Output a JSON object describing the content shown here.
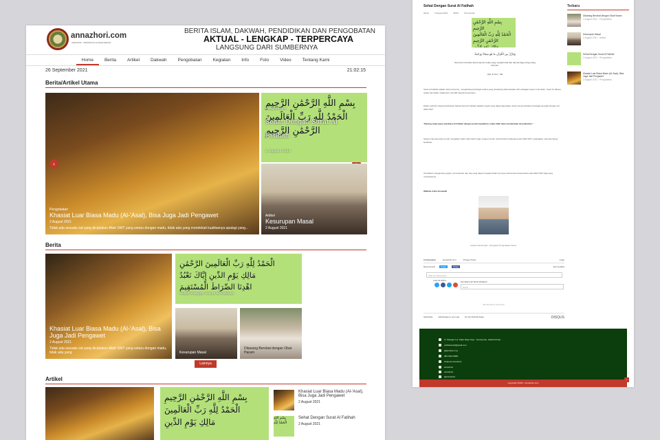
{
  "left": {
    "site": {
      "name": "annazhori.com",
      "tagline": "AMAZHORI - PENDIDIKAN & PENGOBATAN"
    },
    "header": {
      "line1": "BERITA ISLAM, DAKWAH, PENDIDIKAN DAN PENGOBATAN",
      "line2": "AKTUAL - LENGKAP - TERPERCAYA",
      "line3": "LANGSUNG DARI SUMBERNYA"
    },
    "nav": [
      "Home",
      "Berita",
      "Artikel",
      "Dakwah",
      "Pengobatan",
      "Kegiatan",
      "Info",
      "Foto",
      "Video",
      "Tentang Kami"
    ],
    "date": "26 September 2021",
    "time": "21:02:15",
    "sections": {
      "utama": "Berita/Artikel Utama",
      "berita": "Berita",
      "artikel": "Artikel"
    },
    "slider": {
      "category": "Pengobatan",
      "title": "Khasiat Luar Biasa Madu (Al-'Asal), Bisa Juga Jadi Pengawet",
      "date": "2 August 2021",
      "excerpt": "Tidak ada sesuatu zat yang diciptakan Allah SWT yang setaru dengan madu, tidak ada yang mendekati kualitasnya apalagi yang..."
    },
    "featured_side": [
      {
        "category": "Pengobatan",
        "title": "Sehat Dengan Surat Al Fatihah",
        "date": "2 August 2021"
      },
      {
        "category": "Artikel",
        "title": "Kesurupan Masal",
        "date": "2 August 2021"
      }
    ],
    "berita": {
      "main": {
        "title": "Khasiat Luar Biasa Madu (Al-'Asal), Bisa Juga Jadi Pengawet",
        "date": "2 August 2021",
        "excerpt": "Tidak ada sesuatu zat yang diciptakan Allah SWT yang setaru dengan madu, tidak ada yang"
      },
      "top_right": "Sehat Dengan Surat Al Fatihah",
      "small": [
        "Kesurupan Masal",
        "Dikarang Berobat dengan Obat Haram"
      ],
      "more": "Lainnya"
    },
    "artikel_list": [
      {
        "title": "Khasiat Luar Biasa Madu (Al-'Asal), Bisa Juga Jadi Pengawet",
        "date": "2 August 2021"
      },
      {
        "title": "Sehat Dengan Surat Al Fatihah",
        "date": "2 August 2021"
      }
    ]
  },
  "right": {
    "article": {
      "title": "Sehat Dengan Surat Al Fatihah",
      "meta": [
        "admin",
        "2 August 2021",
        "08:00",
        "0 Komentar"
      ],
      "quote": "Dan Kami turunkan dari Al Qur'an suatu yang menjadi obat dan rahmat bagi orang-orang beriman.",
      "cite": "(QS. Al Isra' : 82)",
      "paragraphs": [
        "Surat Al Fatihah adalah induk Al Qur'an, mengandung berbagai makna yang terkadang tidak disadari oleh sebagian besar umat Islam. Surat ini dibaca setiap hari dalam shalat dan memiliki banyak keutamaan.",
        "Dalam sebuah riwayat disebutkan bahwa Surat Al Fatihah adalah ruqyah yang dapat digunakan untuk menyembuhkan berbagai penyakit dengan izin Allah SWT.",
        "\"Barang siapa yang membaca Al Fatihah dengan penuh keyakinan, maka Allah akan memberikan kesembuhan.\"",
        "Setiap manusia pasti pernah mengalami sakit, baik sakit ringan maupun berat. Kesembuhan datangnya dari Allah SWT, sedangkan manusia hanya berikhtiar.",
        "Al Fatihah mengandung pujian, permohonan dan doa yang dapat menjadi sebab turunnya rahmat dan kesembuhan dari Allah SWT bagi yang membacanya."
      ],
      "author": "Wallahu a'lam bissawab",
      "caption": "Ustadz Ahmad Ajid - Pengasuh Pengobatan Islami"
    },
    "comments": {
      "count": "0 Comments",
      "site": "annazhori.com",
      "policy": "Privacy Policy",
      "login": "Login",
      "recommend": "Recommend",
      "tweet": "Tweet",
      "share": "Share",
      "sort": "Sort by Best",
      "placeholder": "Start the discussion...",
      "login_with": "LOG IN WITH",
      "signup": "OR SIGN UP WITH DISQUS",
      "name": "Name",
      "empty": "Be the first to comment.",
      "subscribe": "Subscribe",
      "add_disqus": "Add Disqus to your site",
      "dnsmpd": "Do Not Sell My Data",
      "disqus": "DISQUS"
    },
    "sidebar": {
      "title": "Terbaru",
      "items": [
        {
          "title": "Dikarang Berobat dengan Obat Haram",
          "date": "2 August 2021",
          "label": "Pengobatan"
        },
        {
          "title": "Kesurupan Masal",
          "date": "2 August 2021",
          "label": "Artikel"
        },
        {
          "title": "Sehat Dengan Surat Al Fatihah",
          "date": "2 August 2021",
          "label": "Pengobatan"
        },
        {
          "title": "Khasiat Luar Biasa Madu (Al-'Asal), Bisa Juga Jadi Pengawet",
          "date": "2 August 2021",
          "label": "Pengobatan"
        }
      ]
    },
    "footer": {
      "items": [
        "Jl. Sisingan Lor, Pajar Raya Jaya - Kemayoran, Jakarta Pusat",
        "pelhidesesh@gmail.com",
        "@jasmlaro.org",
        "083 4003 5989",
        "Channel Annazhori",
        "annazhori",
        "annazhori",
        "@annazhori"
      ],
      "copyright": "Copyright ©2021 - Annazhori.com"
    }
  }
}
